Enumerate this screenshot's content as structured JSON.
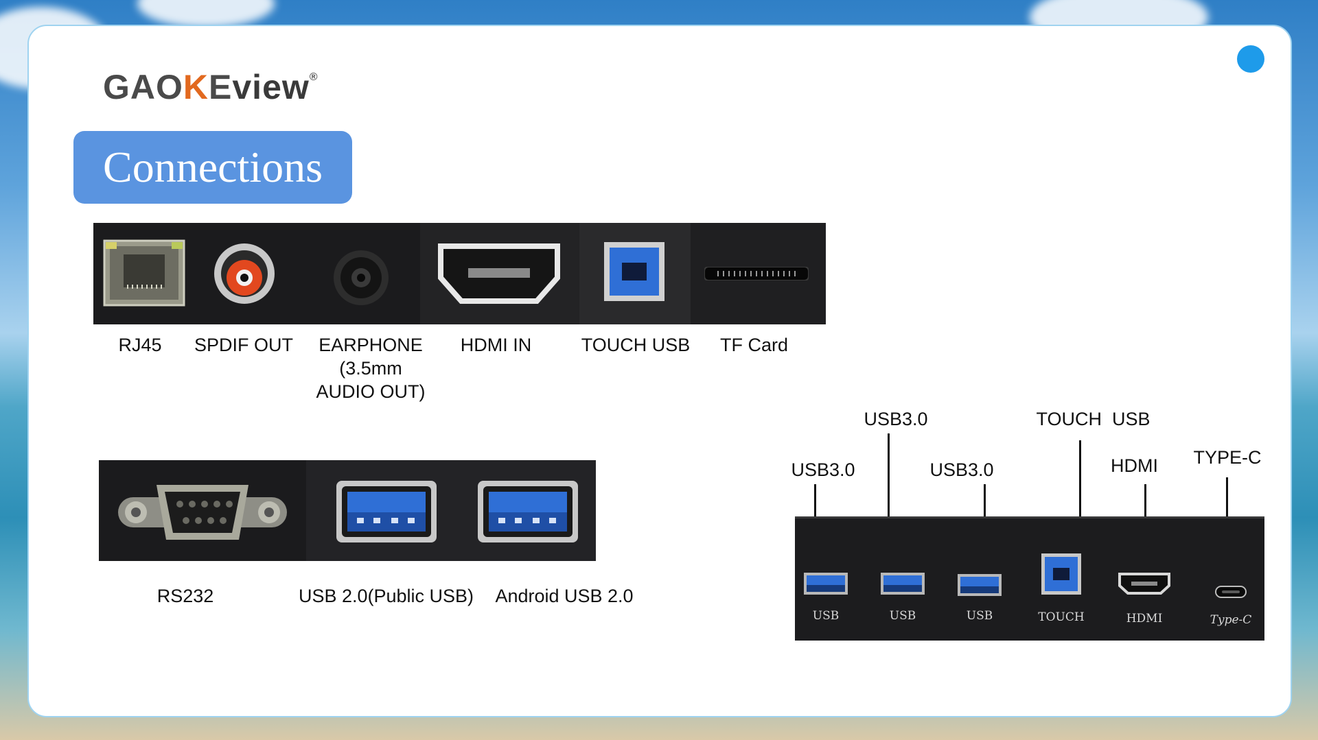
{
  "brand": {
    "logo": "GAOKEview",
    "logo_part1": "GAO",
    "logo_part2": "K",
    "logo_part3": "E",
    "logo_part4": "view",
    "registered": "®"
  },
  "section_title": "Connections",
  "top_panel": {
    "labels": [
      "RJ45",
      "SPDIF OUT",
      "EARPHONE (3.5mm AUDIO OUT)",
      "HDMI IN",
      "TOUCH USB",
      "TF Card"
    ]
  },
  "bottom_left_panel": {
    "labels": [
      "RS232",
      "USB 2.0(Public USB)",
      "Android USB 2.0"
    ]
  },
  "right_panel": {
    "callouts": [
      "USB3.0",
      "USB3.0",
      "USB3.0",
      "TOUCH  USB",
      "HDMI",
      "TYPE-C"
    ],
    "silkscreen": [
      "USB",
      "USB",
      "USB",
      "TOUCH",
      "HDMI",
      "Type-C"
    ]
  },
  "colors": {
    "accent": "#5a94e0",
    "dot": "#1e9bea",
    "panel": "#1b1b1d",
    "usb_blue": "#2f6fd6",
    "rca_red": "#e2481f"
  }
}
